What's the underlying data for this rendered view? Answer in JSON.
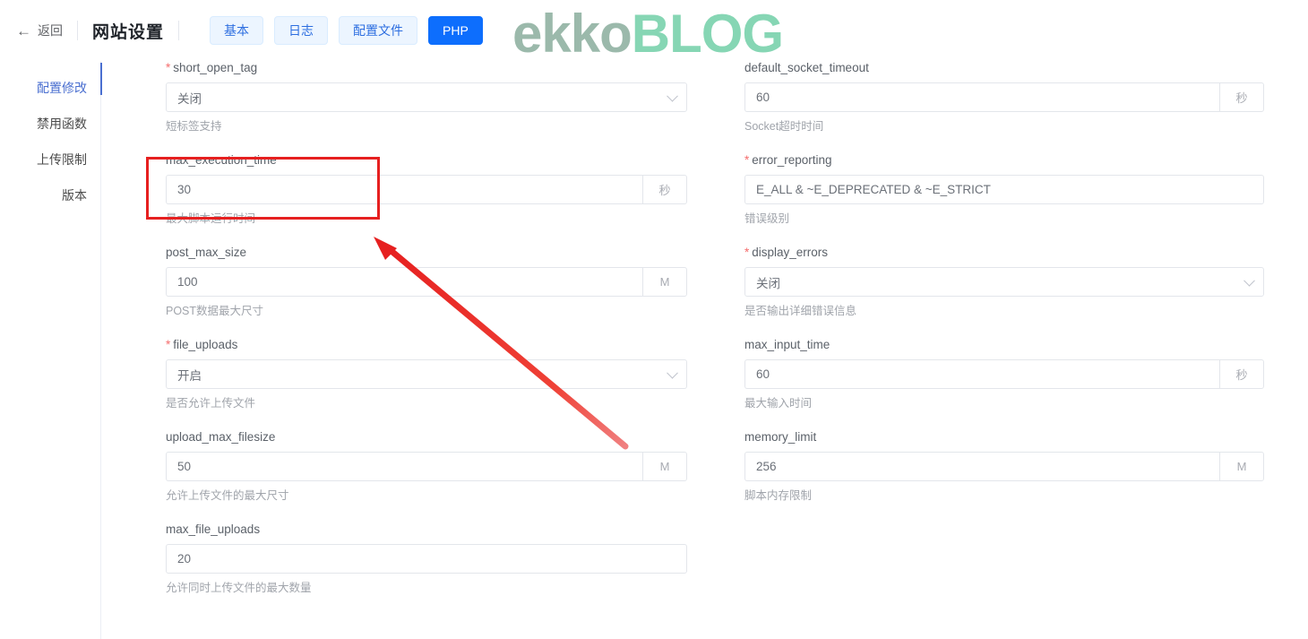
{
  "header": {
    "back_label": "返回",
    "back_icon": "arrow-left-icon",
    "title": "网站设置",
    "tabs": [
      {
        "label": "基本",
        "active": false
      },
      {
        "label": "日志",
        "active": false
      },
      {
        "label": "配置文件",
        "active": false
      },
      {
        "label": "PHP",
        "active": true
      }
    ],
    "active_tab_color": "#0d6efd"
  },
  "sidebar": {
    "items": [
      {
        "label": "配置修改",
        "active": true
      },
      {
        "label": "禁用函数",
        "active": false
      },
      {
        "label": "上传限制",
        "active": false
      },
      {
        "label": "版本",
        "active": false
      }
    ],
    "active_color": "#4a6fd0"
  },
  "watermark": {
    "text_a": "ekko",
    "text_b": "BLOG",
    "color_a": "#9bb9ab",
    "color_b": "#86d6b4"
  },
  "annotations": {
    "highlight_color": "#e62020",
    "box_target": "max_execution_time",
    "arrow_points_to": "max_execution_time"
  },
  "form": {
    "left_column": [
      {
        "name": "short_open_tag",
        "required": true,
        "control": "select",
        "value": "关闭",
        "suffix": "",
        "desc": "短标签支持"
      },
      {
        "name": "max_execution_time",
        "required": false,
        "control": "input",
        "value": "30",
        "suffix": "秒",
        "desc": "最大脚本运行时间"
      },
      {
        "name": "post_max_size",
        "required": false,
        "control": "input",
        "value": "100",
        "suffix": "M",
        "desc": "POST数据最大尺寸"
      },
      {
        "name": "file_uploads",
        "required": true,
        "control": "select",
        "value": "开启",
        "suffix": "",
        "desc": "是否允许上传文件"
      },
      {
        "name": "upload_max_filesize",
        "required": false,
        "control": "input",
        "value": "50",
        "suffix": "M",
        "desc": "允许上传文件的最大尺寸"
      },
      {
        "name": "max_file_uploads",
        "required": false,
        "control": "input",
        "value": "20",
        "suffix": "",
        "desc": "允许同时上传文件的最大数量"
      }
    ],
    "right_column": [
      {
        "name": "default_socket_timeout",
        "required": false,
        "control": "input",
        "value": "60",
        "suffix": "秒",
        "desc": "Socket超时时间"
      },
      {
        "name": "error_reporting",
        "required": true,
        "control": "input",
        "value": "E_ALL & ~E_DEPRECATED & ~E_STRICT",
        "suffix": "",
        "desc": "错误级别"
      },
      {
        "name": "display_errors",
        "required": true,
        "control": "select",
        "value": "关闭",
        "suffix": "",
        "desc": "是否输出详细错误信息"
      },
      {
        "name": "max_input_time",
        "required": false,
        "control": "input",
        "value": "60",
        "suffix": "秒",
        "desc": "最大输入时间"
      },
      {
        "name": "memory_limit",
        "required": false,
        "control": "input",
        "value": "256",
        "suffix": "M",
        "desc": "脚本内存限制"
      }
    ]
  }
}
